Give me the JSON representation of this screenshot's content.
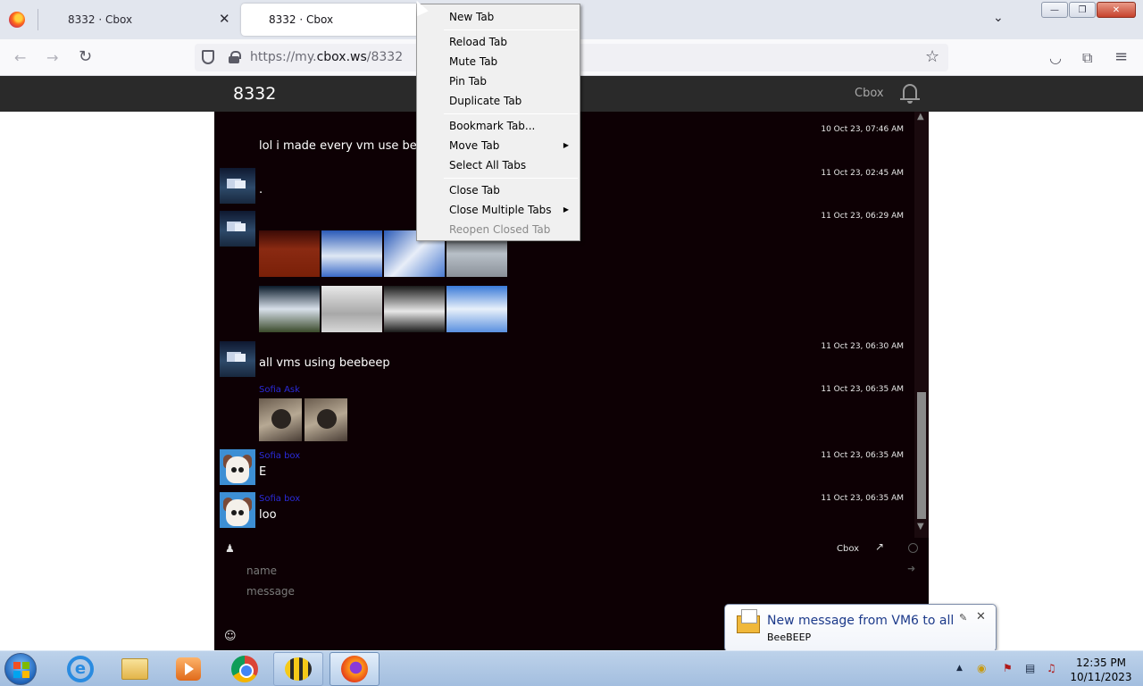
{
  "browser": {
    "tabs": [
      {
        "title": "8332 · Cbox",
        "close": "✕"
      },
      {
        "title": "8332 · Cbox"
      }
    ],
    "tabs_list_icon": "chevron-down",
    "window_controls": {
      "minimize": "—",
      "restore": "❐",
      "close": "✕"
    },
    "url_prefix": "https://my.",
    "url_domain": "cbox.ws",
    "url_path": "/8332",
    "nav": {
      "back": "←",
      "forward": "→",
      "reload": "↻",
      "star": "☆",
      "pocket": "◡",
      "extensions": "⧉",
      "menu": "≡"
    }
  },
  "site": {
    "title": "8332",
    "brand": "Cbox"
  },
  "chat": {
    "messages": [
      {
        "time": "10 Oct 23, 07:46 AM",
        "text": "lol i made every vm use beebeep"
      },
      {
        "time": "11 Oct 23, 02:45 AM",
        "text": "."
      },
      {
        "time": "11 Oct 23, 06:29 AM"
      },
      {
        "time": "11 Oct 23, 06:30 AM",
        "text": "all vms using beebeep"
      },
      {
        "time": "11 Oct 23, 06:35 AM",
        "user": "Sofia Ask"
      },
      {
        "time": "11 Oct 23, 06:35 AM",
        "user": "Sofia box",
        "text": "E"
      },
      {
        "time": "11 Oct 23, 06:35 AM",
        "user": "Sofia box",
        "text": "loo"
      }
    ],
    "compose": {
      "brand": "Cbox",
      "name_placeholder": "name",
      "message_placeholder": "message"
    }
  },
  "context_menu": {
    "items": [
      {
        "label": "New Tab"
      },
      {
        "label": "Reload Tab"
      },
      {
        "label": "Mute Tab"
      },
      {
        "label": "Pin Tab"
      },
      {
        "label": "Duplicate Tab"
      },
      {
        "label": "Bookmark Tab..."
      },
      {
        "label": "Move Tab"
      },
      {
        "label": "Select All Tabs"
      },
      {
        "label": "Close Tab"
      },
      {
        "label": "Close Multiple Tabs"
      },
      {
        "label": "Reopen Closed Tab"
      }
    ]
  },
  "notification": {
    "title": "New message from VM6 to all",
    "app": "BeeBEEP"
  },
  "taskbar": {
    "time": "12:35 PM",
    "date": "10/11/2023"
  },
  "colors": {
    "chat_bg": "#0d0004",
    "header_bg": "#2a2a2a",
    "username": "#2a2ad8"
  }
}
